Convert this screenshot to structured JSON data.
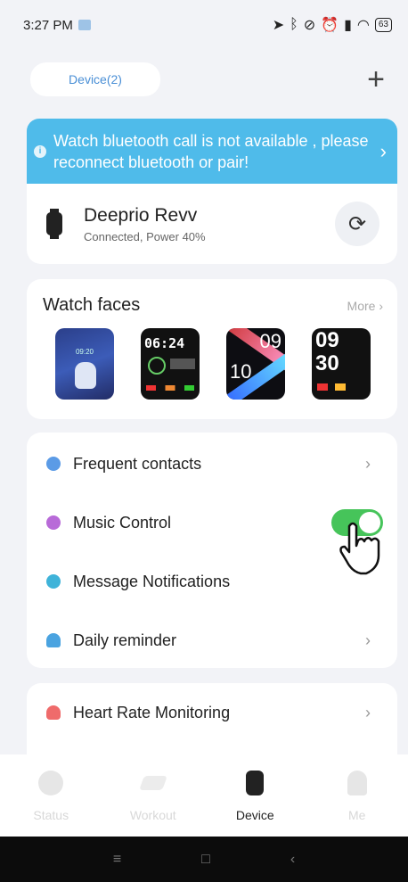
{
  "status_bar": {
    "time": "3:27 PM",
    "right_icons": [
      "location-icon",
      "bluetooth-icon",
      "mute-icon",
      "alarm-icon",
      "signal-icon",
      "wifi-icon"
    ],
    "battery": "63"
  },
  "header": {
    "device_tab": "Device(2)",
    "add_icon": "plus-icon"
  },
  "banner": {
    "text": "Watch bluetooth call is not available , please reconnect bluetooth or pair!",
    "color": "#4fbbea"
  },
  "device": {
    "name": "Deeprio Revv",
    "status": "Connected, Power 40%"
  },
  "watch_faces": {
    "title": "Watch faces",
    "more": "More",
    "faces": [
      {
        "time": "09:20"
      },
      {
        "time": "06:24"
      },
      {
        "top": "09",
        "bottom": "10"
      },
      {
        "top": "09",
        "bottom": "30"
      }
    ]
  },
  "features": [
    {
      "label": "Frequent contacts",
      "icon": "contacts-icon",
      "color": "#5b9be6",
      "control": "chevron"
    },
    {
      "label": "Music Control",
      "icon": "music-icon",
      "color": "#b86ad8",
      "control": "toggle",
      "on": true
    },
    {
      "label": "Message Notifications",
      "icon": "message-icon",
      "color": "#3fb3d9",
      "control": "none"
    },
    {
      "label": "Daily reminder",
      "icon": "bell-icon",
      "color": "#4aa3e0",
      "control": "chevron"
    }
  ],
  "health": {
    "label": "Heart Rate Monitoring",
    "color": "#ef6b6b"
  },
  "tabs": [
    {
      "label": "Status",
      "active": false
    },
    {
      "label": "Workout",
      "active": false
    },
    {
      "label": "Device",
      "active": true
    },
    {
      "label": "Me",
      "active": false
    }
  ],
  "nav": {
    "menu": "≡",
    "home": "□",
    "back": "‹"
  }
}
